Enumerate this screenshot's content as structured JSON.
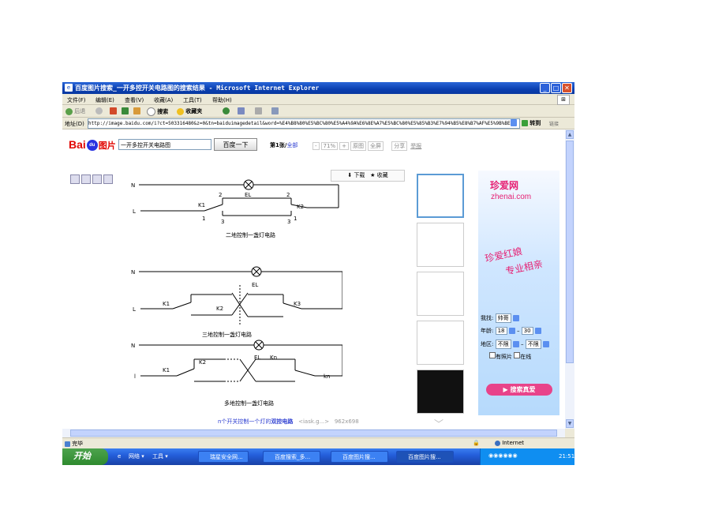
{
  "window": {
    "title": "百度图片搜索_一开多控开关电路图的搜索结果 - Microsoft Internet Explorer"
  },
  "menu": [
    "文件(F)",
    "编辑(E)",
    "查看(V)",
    "收藏(A)",
    "工具(T)",
    "帮助(H)"
  ],
  "toolbar": {
    "back": "后退",
    "search": "搜索",
    "favorites": "收藏夹"
  },
  "address": {
    "label": "地址(D)",
    "url": "http://image.baidu.com/i?ct=503316480&z=0&tn=baiduimagedetail&word=%E4%B8%80%E5%BC%80%E5%A4%9A%E6%8E%A7%E5%BC%80%E5%85%B3%E7%94%B5%E8%B7%AF%E5%9B%BE",
    "go": "转到",
    "links": "链接"
  },
  "baidu": {
    "logo_bai": "Bai",
    "logo_du": "du",
    "logo_tupian": "图片",
    "query": "一开多控开关电路图",
    "search_button": "百度一下",
    "page_label": "第1张/",
    "page_all": "全部",
    "zoom": "71%",
    "original": "原图",
    "fullscreen": "全屏",
    "share": "分享",
    "report": "举报"
  },
  "viewer": {
    "download": "下载",
    "collect": "收藏"
  },
  "circuit": {
    "d1": {
      "N": "N",
      "L": "L",
      "EL": "EL",
      "K1": "K1",
      "K2": "K2",
      "n2a": "2",
      "n2b": "2",
      "n1a": "1",
      "n1b": "1",
      "n3a": "3",
      "n3b": "3",
      "caption": "二地控制一盏灯电路"
    },
    "d2": {
      "N": "N",
      "L": "L",
      "EL": "EL",
      "K1": "K1",
      "K2": "K2",
      "K3": "K3",
      "caption": "三地控制一盏灯电路"
    },
    "d3": {
      "N": "N",
      "L": "l",
      "EL": "EL",
      "Kn_top": "Kn",
      "K1": "K1",
      "K2": "K2",
      "kn": "kn",
      "caption": "多地控制一盏灯电路"
    }
  },
  "image_caption": {
    "prefix": "n个开关控制一个灯的",
    "link": "双控电路",
    "source": "<iask.g...>",
    "size": "962x698"
  },
  "ad": {
    "brand": "珍爱网",
    "url": "zhenai.com",
    "slogan1": "珍爱红娘",
    "slogan2": "专业相亲",
    "find_label": "我找:",
    "find_value": "帅哥",
    "age_label": "年龄:",
    "age_from": "18",
    "age_to": "30",
    "region_label": "地区:",
    "region_a": "不限",
    "region_b": "不限",
    "photo_check": "有照片",
    "online_check": "在线",
    "cta": "搜索真爱"
  },
  "status": {
    "left": "完毕",
    "zone": "Internet"
  },
  "taskbar": {
    "start": "开始",
    "net": "网络",
    "tools": "工具",
    "tasks": [
      "瑞星安全网...",
      "百度搜索_多...",
      "百度图片搜...",
      "百度图片搜..."
    ],
    "clock": "21:51"
  }
}
